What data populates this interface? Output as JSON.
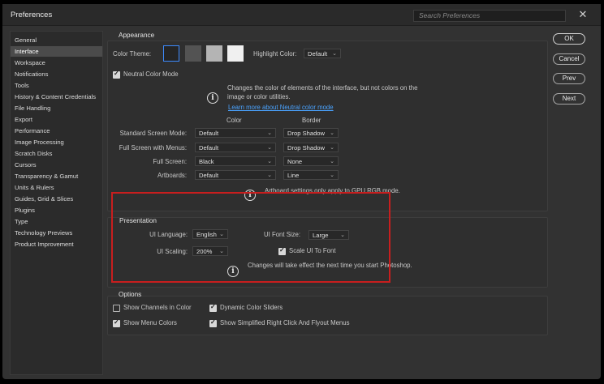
{
  "window": {
    "title": "Preferences",
    "search_placeholder": "Search Preferences"
  },
  "sidebar": {
    "items": [
      {
        "label": "General"
      },
      {
        "label": "Interface",
        "selected": true
      },
      {
        "label": "Workspace"
      },
      {
        "label": "Notifications"
      },
      {
        "label": "Tools"
      },
      {
        "label": "History & Content Credentials"
      },
      {
        "label": "File Handling"
      },
      {
        "label": "Export"
      },
      {
        "label": "Performance"
      },
      {
        "label": "Image Processing"
      },
      {
        "label": "Scratch Disks"
      },
      {
        "label": "Cursors"
      },
      {
        "label": "Transparency & Gamut"
      },
      {
        "label": "Units & Rulers"
      },
      {
        "label": "Guides, Grid & Slices"
      },
      {
        "label": "Plugins"
      },
      {
        "label": "Type"
      },
      {
        "label": "Technology Previews"
      },
      {
        "label": "Product Improvement"
      }
    ]
  },
  "appearance": {
    "title": "Appearance",
    "color_theme_label": "Color Theme:",
    "theme_swatches": [
      "#252525",
      "#535353",
      "#b4b4b4",
      "#f0f0f0"
    ],
    "highlight_label": "Highlight Color:",
    "highlight_value": "Default",
    "neutral_mode_label": "Neutral Color Mode",
    "neutral_info_line1": "Changes the color of elements of the interface, but not colors on the",
    "neutral_info_line2": "image or color utilities.",
    "neutral_link": "Learn more about Neutral color mode",
    "col_color": "Color",
    "col_border": "Border",
    "rows": [
      {
        "label": "Standard Screen Mode:",
        "color": "Default",
        "border": "Drop Shadow"
      },
      {
        "label": "Full Screen with Menus:",
        "color": "Default",
        "border": "Drop Shadow"
      },
      {
        "label": "Full Screen:",
        "color": "Black",
        "border": "None"
      },
      {
        "label": "Artboards:",
        "color": "Default",
        "border": "Line"
      }
    ],
    "artboard_note": "Artboard settings only apply to GPU RGB mode."
  },
  "presentation": {
    "title": "Presentation",
    "language_label": "UI Language:",
    "language_value": "English",
    "font_size_label": "UI Font Size:",
    "font_size_value": "Large",
    "scaling_label": "UI Scaling:",
    "scaling_value": "200%",
    "scale_font_label": "Scale UI To Font",
    "note": "Changes will take effect the next time you start Photoshop."
  },
  "options": {
    "title": "Options",
    "items": [
      {
        "label": "Show Channels in Color",
        "checked": false
      },
      {
        "label": "Dynamic Color Sliders",
        "checked": true
      },
      {
        "label": "Show Menu Colors",
        "checked": true
      },
      {
        "label": "Show Simplified Right Click And Flyout Menus",
        "checked": true
      }
    ]
  },
  "buttons": {
    "ok": "OK",
    "cancel": "Cancel",
    "prev": "Prev",
    "next": "Next"
  },
  "icons": {
    "close": "close-icon",
    "info": "info-icon",
    "chevron": "chevron-down-icon",
    "check": "checkmark-icon"
  },
  "colors": {
    "highlight_annotation": "#c81e1e",
    "link": "#4aa3ff"
  }
}
